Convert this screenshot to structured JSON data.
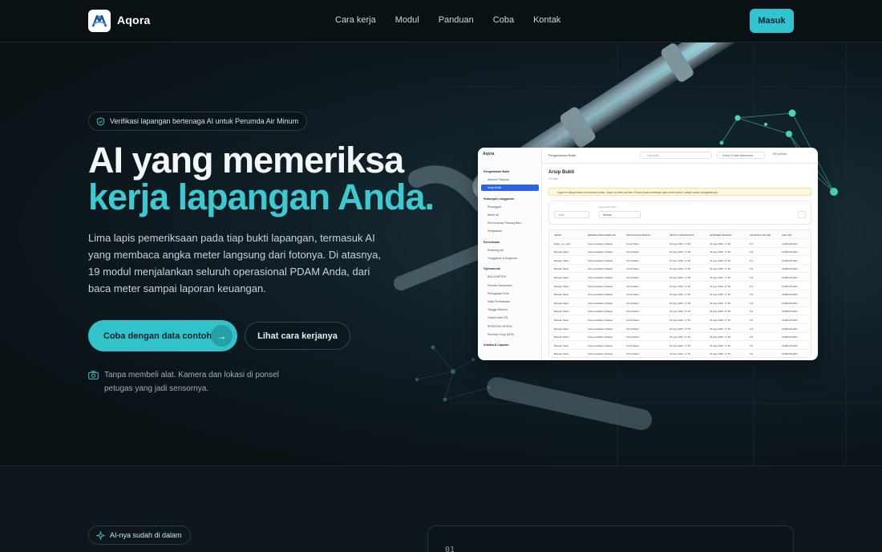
{
  "nav": {
    "brand": "Aqora",
    "links": [
      "Cara kerja",
      "Modul",
      "Panduan",
      "Coba",
      "Kontak"
    ],
    "login": "Masuk"
  },
  "hero": {
    "badge": "Verifikasi lapangan bertenaga AI untuk Perumda Air Minum",
    "title_line1": "AI yang memeriksa",
    "title_line2": "kerja lapangan Anda.",
    "lead": "Lima lapis pemeriksaan pada tiap bukti lapangan, termasuk AI yang membaca angka meter langsung dari fotonya. Di atasnya, 19 modul menjalankan seluruh operasional PDAM Anda, dari baca meter sampai laporan keuangan.",
    "cta_primary": "Coba dengan data contoh",
    "cta_secondary": "Lihat cara kerjanya",
    "note": "Tanpa membeli alat. Kamera dan lokasi di ponsel petugas yang jadi sensornya."
  },
  "mockup": {
    "logo": "Aqora",
    "sidebar": [
      {
        "label": "Pengamanan Bukti",
        "type": "head"
      },
      {
        "label": "Antrean Tinjauan",
        "type": "item"
      },
      {
        "label": "Arsip Bukti",
        "type": "active"
      },
      {
        "label": "Hubungan Langganan",
        "type": "head"
      },
      {
        "label": "Pelanggan",
        "type": "item"
      },
      {
        "label": "Meter Air",
        "type": "item"
      },
      {
        "label": "Permohonan Pasang Baru",
        "type": "item"
      },
      {
        "label": "Pengaduan",
        "type": "item"
      },
      {
        "label": "Penerimaan",
        "type": "head"
      },
      {
        "label": "Rekening Air",
        "type": "item"
      },
      {
        "label": "Tunggakan & Angsuran",
        "type": "item"
      },
      {
        "label": "Operasional",
        "type": "head"
      },
      {
        "label": "BACA METER",
        "type": "item"
      },
      {
        "label": "Periode Bacameter",
        "type": "item"
      },
      {
        "label": "Penugasan Rute",
        "type": "item"
      },
      {
        "label": "Hasil Pembacaan",
        "type": "item"
      },
      {
        "label": "Tangga Sinkron",
        "type": "item"
      },
      {
        "label": "Cetak Kartu DR",
        "type": "item"
      },
      {
        "label": "PERINTAH KERJA",
        "type": "item"
      },
      {
        "label": "Perintah Kerja (SPK)",
        "type": "item"
      },
      {
        "label": "Analisa & Laporan",
        "type": "head"
      }
    ],
    "breadcrumb": "Pengamanan Bukti",
    "search": "Cari bukti",
    "office": "Kantor Pusat Mahamera",
    "user": "Sih Aninda",
    "page_title": "Arsip Bukti",
    "page_sub": "12 bukti",
    "alert": "Layar ini hanya baca untuk peran Anda. Layar ini milik unit lain. Peran Anda membaca saja untuk kontrol, bukan untuk mengubahnya.",
    "filter_search": "Jenis",
    "filter_label": "Keputusan Akhir",
    "filter_value": "Semua",
    "columns": [
      "JENIS",
      "NOMOR PENGAMBILAN",
      "KETAHANAN WAKTU",
      "WAKTU PERANGKAT",
      "DITERIMA SERVER",
      "AKURASI GPS (M)",
      "SHA-256"
    ],
    "rows": [
      [
        "failed_nol_card",
        "Kamera Dalam Aplikasi",
        "TerverWaist",
        "24 Agu 2026, 17.56",
        "24 Agu 2026, 17.56",
        "6,5",
        "c9d6ba67a3b3"
      ],
      [
        "Bacaan Meter",
        "Kamera Dalam Aplikasi",
        "TerverWaist",
        "24 Agu 2026, 17.56",
        "24 Agu 2026, 17.56",
        "6,5",
        "c9d6ba67a3b3"
      ],
      [
        "Bacaan Meter",
        "Kamera Dalam Aplikasi",
        "TerverWaist",
        "24 Agu 2026, 17.56",
        "24 Agu 2026, 17.56",
        "6,5",
        "c9d6ba67a3b3"
      ],
      [
        "Bacaan Meter",
        "Kamera Dalam Aplikasi",
        "TerverWaist",
        "24 Agu 2026, 17.56",
        "24 Agu 2026, 17.56",
        "6,5",
        "c9d6ba67a3b3"
      ],
      [
        "Bacaan Meter",
        "Kamera Dalam Aplikasi",
        "TerverWaist",
        "24 Agu 2026, 17.56",
        "24 Agu 2026, 17.56",
        "6,5",
        "c9d6ba67a3b3"
      ],
      [
        "Bacaan Meter",
        "Kamera Dalam Aplikasi",
        "TerverWaist",
        "24 Agu 2026, 17.56",
        "24 Agu 2026, 17.56",
        "6,5",
        "c9d6ba67a3b3"
      ],
      [
        "Bacaan Meter",
        "Kamera Dalam Aplikasi",
        "TerverWaist",
        "24 Agu 2026, 17.56",
        "24 Agu 2026, 17.56",
        "6,5",
        "c9d6ba67a3b3"
      ],
      [
        "Bacaan Meter",
        "Kamera Dalam Aplikasi",
        "TerverWaist",
        "24 Agu 2026, 17.56",
        "24 Agu 2026, 17.56",
        "6,5",
        "c9d6ba67a3b3"
      ],
      [
        "Bacaan Meter",
        "Kamera Dalam Aplikasi",
        "TerverWaist",
        "24 Agu 2026, 17.56",
        "24 Agu 2026, 17.56",
        "6,5",
        "c9d6ba67a3b3"
      ],
      [
        "Bacaan Meter",
        "Kamera Dalam Aplikasi",
        "TerverWaist",
        "24 Agu 2026, 17.53",
        "24 Agu 2026, 17.53",
        "6,5",
        "c9d6ba67a3b3"
      ],
      [
        "Bacaan Meter",
        "Kamera Dalam Aplikasi",
        "TerverWaist",
        "24 Agu 2026, 17.53",
        "24 Agu 2026, 17.53",
        "6,5",
        "c9d6ba67a3b3"
      ],
      [
        "Bacaan Meter",
        "Kamera Dalam Aplikasi",
        "TerverWaist",
        "24 Agu 2026, 17.53",
        "24 Agu 2026, 17.53",
        "6,5",
        "c9d6ba67a3b3"
      ],
      [
        "Bacaan Meter",
        "Kamera Dalam Aplikasi",
        "TerverWaist",
        "24 Agu 2026, 17.53",
        "24 Agu 2026, 17.53",
        "6,5",
        "c9d6ba67a3b3"
      ],
      [
        "Bacaan Meter",
        "Kamera Dalam Aplikasi",
        "TerverWaist",
        "24 Agu 2026, 17.53",
        "24 Agu 2026, 17.53",
        "6,5",
        "c9d6ba67a3b3"
      ]
    ]
  },
  "section2": {
    "badge": "AI-nya sudah di dalam",
    "code_num": "01"
  },
  "colors": {
    "accent": "#32c2ca",
    "background": "#0a1216",
    "title_accent": "#3cc9cf"
  },
  "icons": {
    "logo": "water-drop-logo-icon",
    "badge": "shield-check-icon",
    "arrow": "arrow-right-icon",
    "note": "camera-icon",
    "badge2": "sparkle-icon"
  }
}
